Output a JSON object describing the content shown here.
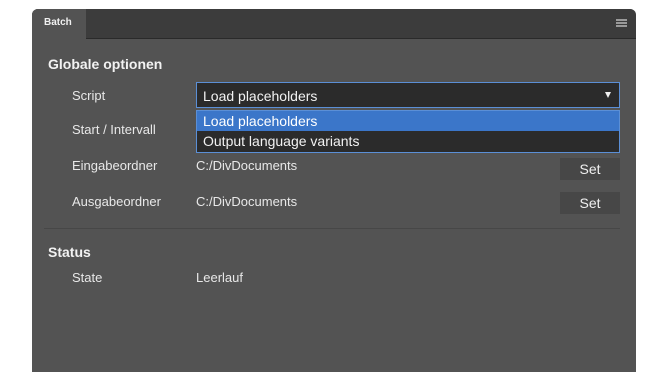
{
  "tab": {
    "title": "Batch"
  },
  "sections": {
    "global": {
      "title": "Globale optionen",
      "script_label": "Script",
      "script_value": "Load placeholders",
      "script_options": [
        "Load placeholders",
        "Output language variants"
      ],
      "start_label": "Start / Intervall",
      "input_label": "Eingabeordner",
      "input_value": "C:/DivDocuments",
      "output_label": "Ausgabeordner",
      "output_value": "C:/DivDocuments",
      "set_label": "Set"
    },
    "status": {
      "title": "Status",
      "state_label": "State",
      "state_value": "Leerlauf"
    }
  },
  "colors": {
    "panel": "#535353",
    "accent": "#3b76c9",
    "field": "#2b2b2b"
  },
  "icons": {
    "panel_menu": "hamburger-menu-icon",
    "dropdown_arrow": "caret-down-icon"
  }
}
